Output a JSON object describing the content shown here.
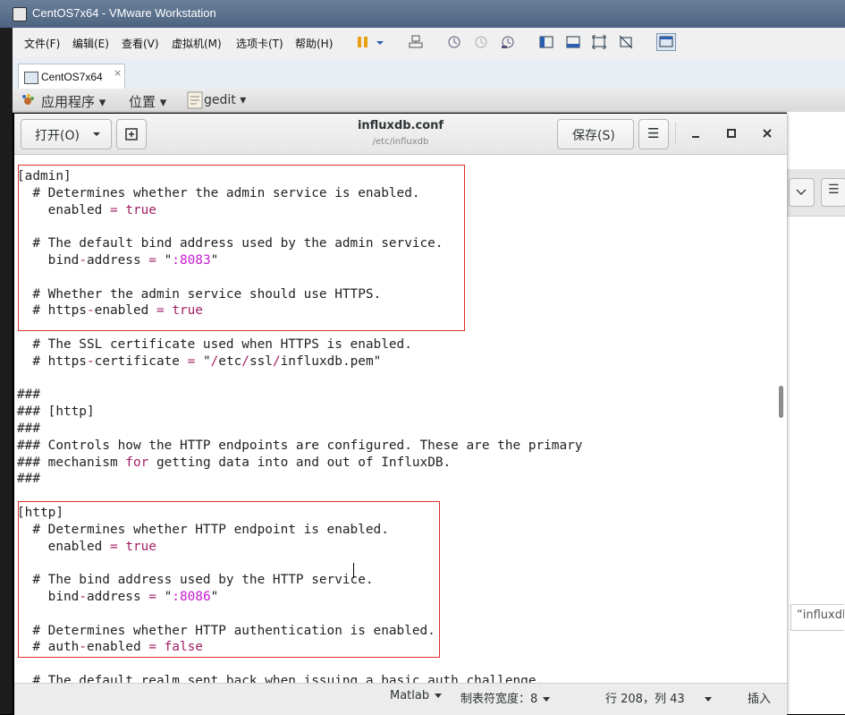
{
  "vmware": {
    "title": "CentOS7x64 - VMware Workstation",
    "menu": [
      "文件(F)",
      "编辑(E)",
      "查看(V)",
      "虚拟机(M)",
      "选项卡(T)",
      "帮助(H)"
    ],
    "tab_label": "CentOS7x64"
  },
  "gnome_panel": {
    "applications": "应用程序 ▾",
    "places": "位置 ▾",
    "app": "gedit ▾"
  },
  "gedit": {
    "open_label": "打开(O)",
    "title": "influxdb.conf",
    "subtitle": "/etc/influxdb",
    "save_label": "保存(S)"
  },
  "editor": {
    "lines": [
      [
        [
          "",
          "[admin]"
        ]
      ],
      [
        [
          "",
          "  # Determines whether the admin service is enabled."
        ]
      ],
      [
        [
          "",
          "    enabled "
        ],
        [
          "kw",
          "="
        ],
        [
          "",
          " "
        ],
        [
          "kw",
          "true"
        ]
      ],
      [
        [
          "",
          ""
        ]
      ],
      [
        [
          "",
          "  # The default bind address used by the admin service."
        ]
      ],
      [
        [
          "",
          "    bind"
        ],
        [
          "kw",
          "-"
        ],
        [
          "",
          "address "
        ],
        [
          "kw",
          "="
        ],
        [
          "",
          " \""
        ],
        [
          "str",
          ":8083"
        ],
        [
          "",
          "\""
        ]
      ],
      [
        [
          "",
          ""
        ]
      ],
      [
        [
          "",
          "  # Whether the admin service should use HTTPS."
        ]
      ],
      [
        [
          "",
          "  # https"
        ],
        [
          "kw",
          "-"
        ],
        [
          "",
          "enabled "
        ],
        [
          "kw",
          "="
        ],
        [
          "",
          " "
        ],
        [
          "kw",
          "true"
        ]
      ],
      [
        [
          "",
          ""
        ]
      ],
      [
        [
          "",
          "  # The SSL certificate used when HTTPS is enabled."
        ]
      ],
      [
        [
          "",
          "  # https"
        ],
        [
          "kw",
          "-"
        ],
        [
          "",
          "certificate "
        ],
        [
          "kw",
          "="
        ],
        [
          "",
          " \""
        ],
        [
          "kw",
          "/"
        ],
        [
          "",
          "etc"
        ],
        [
          "kw",
          "/"
        ],
        [
          "",
          "ssl"
        ],
        [
          "kw",
          "/"
        ],
        [
          "",
          "influxdb.pem\""
        ]
      ],
      [
        [
          "",
          ""
        ]
      ],
      [
        [
          "",
          "###"
        ]
      ],
      [
        [
          "",
          "### [http]"
        ]
      ],
      [
        [
          "",
          "###"
        ]
      ],
      [
        [
          "",
          "### Controls how the HTTP endpoints are configured. These are the primary"
        ]
      ],
      [
        [
          "",
          "### mechanism "
        ],
        [
          "kw",
          "for"
        ],
        [
          "",
          " getting data into and out of InfluxDB."
        ]
      ],
      [
        [
          "",
          "###"
        ]
      ],
      [
        [
          "",
          ""
        ]
      ],
      [
        [
          "",
          "[http]"
        ]
      ],
      [
        [
          "",
          "  # Determines whether HTTP endpoint is enabled."
        ]
      ],
      [
        [
          "",
          "    enabled "
        ],
        [
          "kw",
          "="
        ],
        [
          "",
          " "
        ],
        [
          "kw",
          "true"
        ]
      ],
      [
        [
          "",
          ""
        ]
      ],
      [
        [
          "",
          "  # The bind address used by the HTTP service."
        ]
      ],
      [
        [
          "",
          "    bind"
        ],
        [
          "kw",
          "-"
        ],
        [
          "",
          "address "
        ],
        [
          "kw",
          "="
        ],
        [
          "",
          " \""
        ],
        [
          "str",
          ":8086"
        ],
        [
          "",
          "\""
        ]
      ],
      [
        [
          "",
          ""
        ]
      ],
      [
        [
          "",
          "  # Determines whether HTTP authentication is enabled."
        ]
      ],
      [
        [
          "",
          "  # auth"
        ],
        [
          "kw",
          "-"
        ],
        [
          "",
          "enabled "
        ],
        [
          "kw",
          "="
        ],
        [
          "",
          " "
        ],
        [
          "kw",
          "false"
        ]
      ],
      [
        [
          "",
          ""
        ]
      ],
      [
        [
          "",
          "  # The default realm sent back when issuing a basic auth challenge."
        ]
      ]
    ]
  },
  "statusbar": {
    "language": "Matlab",
    "tab_width": "制表符宽度：8",
    "position": "行 208，列 43",
    "mode": "插入"
  },
  "background": {
    "snippet": "“influxdb"
  },
  "colors": {
    "keyword": "#a11f63",
    "string": "#c71ccf",
    "highlight_box": "#e02d2d"
  }
}
